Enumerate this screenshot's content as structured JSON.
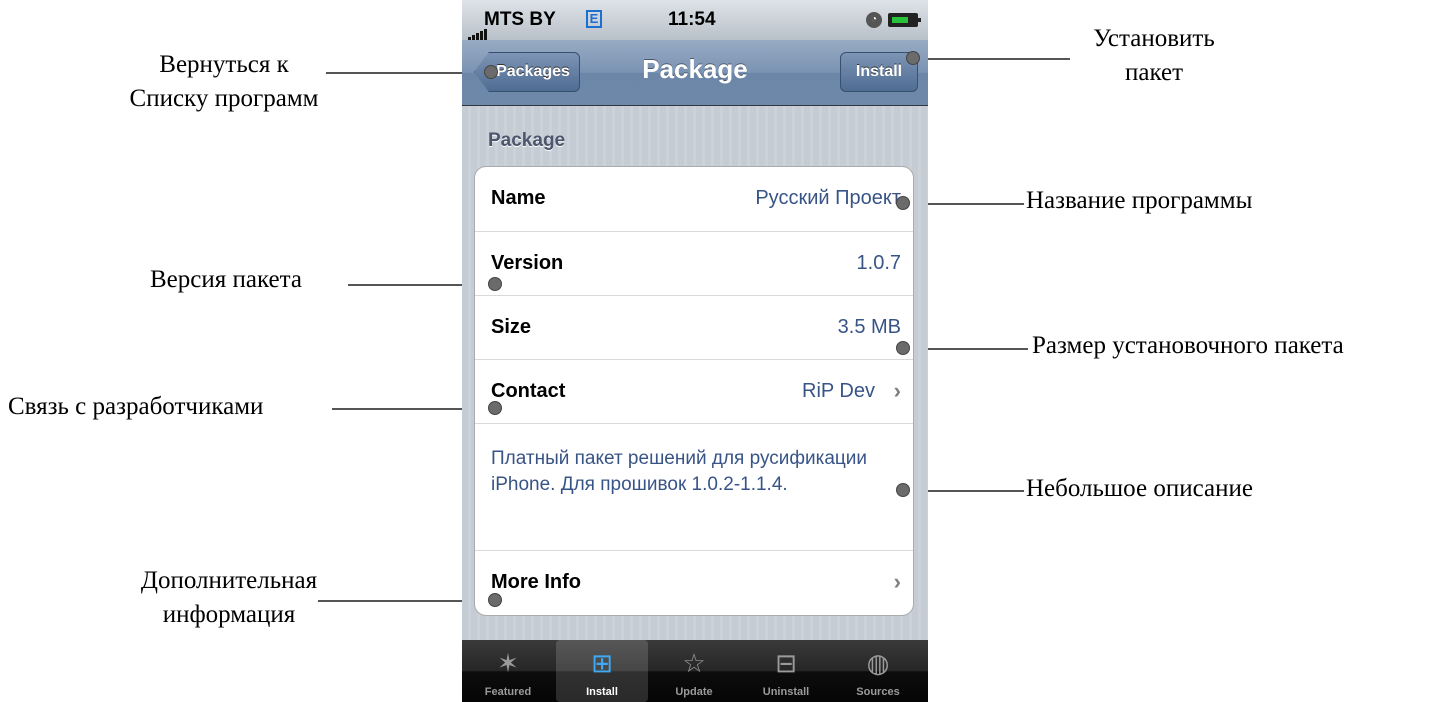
{
  "status_bar": {
    "carrier": "MTS BY",
    "network": "E",
    "time": "11:54"
  },
  "nav": {
    "back_label": "Packages",
    "title": "Package",
    "install_label": "Install"
  },
  "section_header": "Package",
  "rows": {
    "name": {
      "label": "Name",
      "value": "Русский Проект"
    },
    "version": {
      "label": "Version",
      "value": "1.0.7"
    },
    "size": {
      "label": "Size",
      "value": "3.5 MB"
    },
    "contact": {
      "label": "Contact",
      "value": "RiP Dev"
    },
    "description": "Платный пакет решений для русификации iPhone. Для прошивок 1.0.2-1.1.4.",
    "more_info": {
      "label": "More Info"
    }
  },
  "tabs": [
    {
      "label": "Featured",
      "icon": "featured-icon"
    },
    {
      "label": "Install",
      "icon": "install-icon",
      "selected": true
    },
    {
      "label": "Update",
      "icon": "update-icon"
    },
    {
      "label": "Uninstall",
      "icon": "uninstall-icon"
    },
    {
      "label": "Sources",
      "icon": "globe-icon"
    }
  ],
  "annotations": {
    "back": "Вернуться к\nСписку программ",
    "install": "Установить\nпакет",
    "name": "Название программы",
    "version": "Версия пакета",
    "size": "Размер установочного пакета",
    "contact": "Связь с разработчиками",
    "description": "Небольшое описание",
    "more_info": "Дополнительная\nинформация"
  },
  "colors": {
    "accent": "#385487",
    "tab_selected": "#3ea9f5",
    "nav": "#6f89ab"
  }
}
